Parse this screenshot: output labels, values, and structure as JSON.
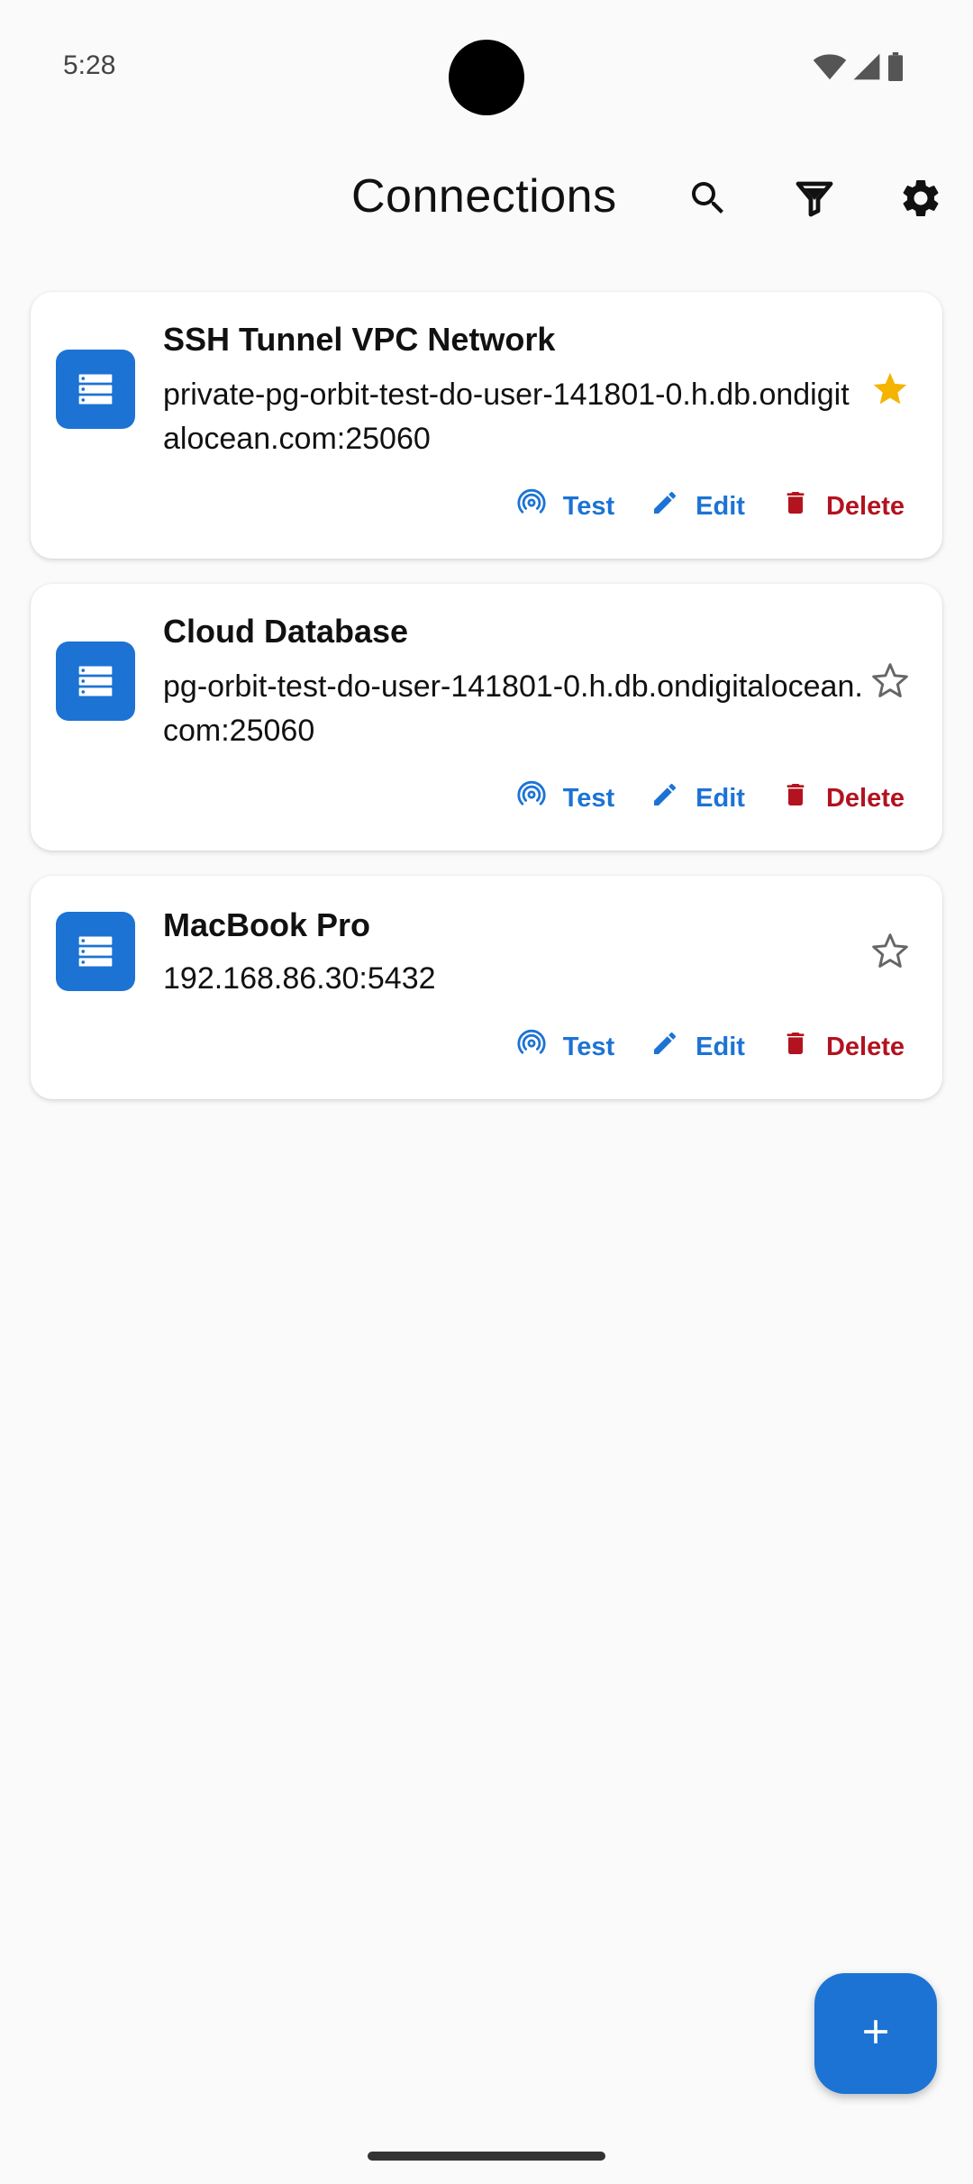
{
  "status_bar": {
    "time": "5:28"
  },
  "app_bar": {
    "title": "Connections",
    "actions": [
      "search-icon",
      "filter-icon",
      "gear-icon"
    ]
  },
  "colors": {
    "accent": "#1c73d4",
    "danger": "#b3121f",
    "favorite": "#f4b400"
  },
  "connections": [
    {
      "name": "SSH Tunnel VPC Network",
      "host": "private-pg-orbit-test-do-user-141801-0.h.db.ondigitalocean.com:25060",
      "favorite": true,
      "actions": {
        "test": "Test",
        "edit": "Edit",
        "delete": "Delete"
      }
    },
    {
      "name": "Cloud Database",
      "host": "pg-orbit-test-do-user-141801-0.h.db.ondigitalocean.com:25060",
      "favorite": false,
      "actions": {
        "test": "Test",
        "edit": "Edit",
        "delete": "Delete"
      }
    },
    {
      "name": "MacBook Pro",
      "host": "192.168.86.30:5432",
      "favorite": false,
      "actions": {
        "test": "Test",
        "edit": "Edit",
        "delete": "Delete"
      }
    }
  ],
  "fab": {
    "icon": "plus-icon"
  }
}
